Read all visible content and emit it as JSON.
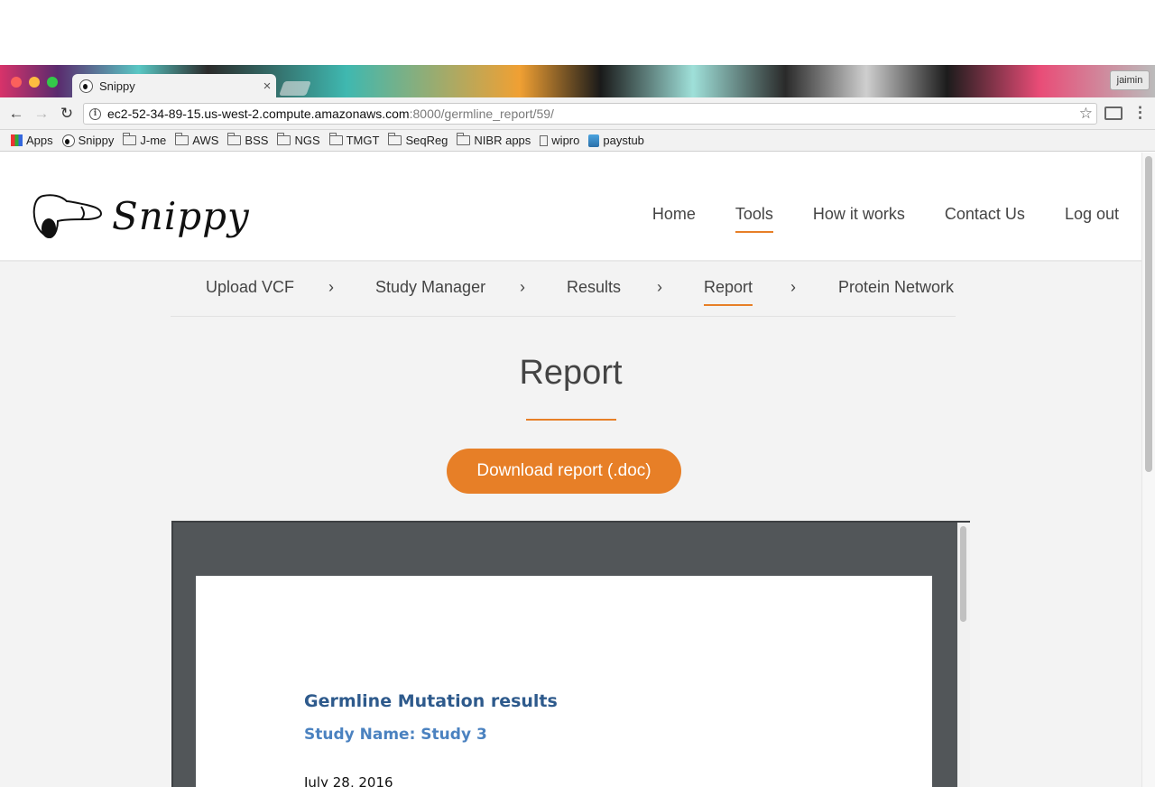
{
  "browser": {
    "tab_title": "Snippy",
    "tab_close": "×",
    "profile_name": "jaimin",
    "url_host": "ec2-52-34-89-15.us-west-2.compute.amazonaws.com",
    "url_path": ":8000/germline_report/59/",
    "bookmarks": [
      {
        "label": "Apps",
        "icon": "apps-icon"
      },
      {
        "label": "Snippy",
        "icon": "snippy-favicon"
      },
      {
        "label": "J-me",
        "icon": "folder-icon"
      },
      {
        "label": "AWS",
        "icon": "folder-icon"
      },
      {
        "label": "BSS",
        "icon": "folder-icon"
      },
      {
        "label": "NGS",
        "icon": "folder-icon"
      },
      {
        "label": "TMGT",
        "icon": "folder-icon"
      },
      {
        "label": "SeqReg",
        "icon": "folder-icon"
      },
      {
        "label": "NIBR apps",
        "icon": "folder-icon"
      },
      {
        "label": "wipro",
        "icon": "page-icon"
      },
      {
        "label": "paystub",
        "icon": "paystub-icon"
      }
    ]
  },
  "site": {
    "logo_text": "Snippy",
    "nav": [
      {
        "label": "Home",
        "active": false
      },
      {
        "label": "Tools",
        "active": true
      },
      {
        "label": "How it works",
        "active": false
      },
      {
        "label": "Contact Us",
        "active": false
      },
      {
        "label": "Log out",
        "active": false
      }
    ],
    "steps": [
      {
        "label": "Upload VCF",
        "active": false
      },
      {
        "label": "Study Manager",
        "active": false
      },
      {
        "label": "Results",
        "active": false
      },
      {
        "label": "Report",
        "active": true
      },
      {
        "label": "Protein Network",
        "active": false
      }
    ],
    "step_separator": "›",
    "accent_color": "#e77f27"
  },
  "main": {
    "title": "Report",
    "download_label": "Download report (.doc)"
  },
  "document": {
    "heading": "Germline Mutation results",
    "study_name": "Study Name: Study 3",
    "date": "July 28, 2016"
  }
}
